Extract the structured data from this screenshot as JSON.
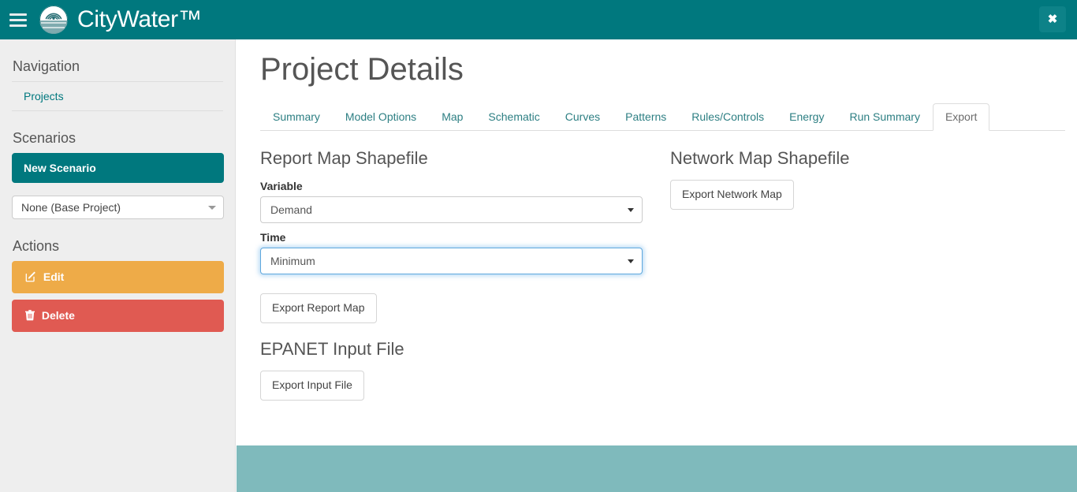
{
  "navbar": {
    "brand": "CityWater™",
    "menu_icon": "hamburger-icon",
    "logo_icon": "citywater-logo",
    "close_label": "✖"
  },
  "sidebar": {
    "navigation_heading": "Navigation",
    "nav_items": [
      {
        "label": "Projects"
      }
    ],
    "scenarios_heading": "Scenarios",
    "new_scenario_label": "New Scenario",
    "scenario_select_value": "None (Base Project)",
    "actions_heading": "Actions",
    "actions": [
      {
        "label": "Edit",
        "icon": "edit-pencil-icon",
        "color": "#eeab48"
      },
      {
        "label": "Delete",
        "icon": "trash-icon",
        "color": "#e05a52"
      }
    ]
  },
  "main": {
    "page_title": "Project Details",
    "tabs": [
      {
        "label": "Summary",
        "active": false
      },
      {
        "label": "Model Options",
        "active": false
      },
      {
        "label": "Map",
        "active": false
      },
      {
        "label": "Schematic",
        "active": false
      },
      {
        "label": "Curves",
        "active": false
      },
      {
        "label": "Patterns",
        "active": false
      },
      {
        "label": "Rules/Controls",
        "active": false
      },
      {
        "label": "Energy",
        "active": false
      },
      {
        "label": "Run Summary",
        "active": false
      },
      {
        "label": "Export",
        "active": true
      }
    ],
    "report_map": {
      "section_title": "Report Map Shapefile",
      "variable_label": "Variable",
      "variable_value": "Demand",
      "time_label": "Time",
      "time_value": "Minimum",
      "export_button": "Export Report Map"
    },
    "epanet": {
      "section_title": "EPANET Input File",
      "export_button": "Export Input File"
    },
    "network_map": {
      "section_title": "Network Map Shapefile",
      "export_button": "Export Network Map"
    }
  },
  "theme": {
    "primary_teal": "#00787e",
    "footer_teal": "#7fbabc",
    "link_teal": "#2d7f83",
    "edit_orange": "#eeab48",
    "delete_red": "#e05a52",
    "sidebar_gray": "#eeeeee"
  }
}
